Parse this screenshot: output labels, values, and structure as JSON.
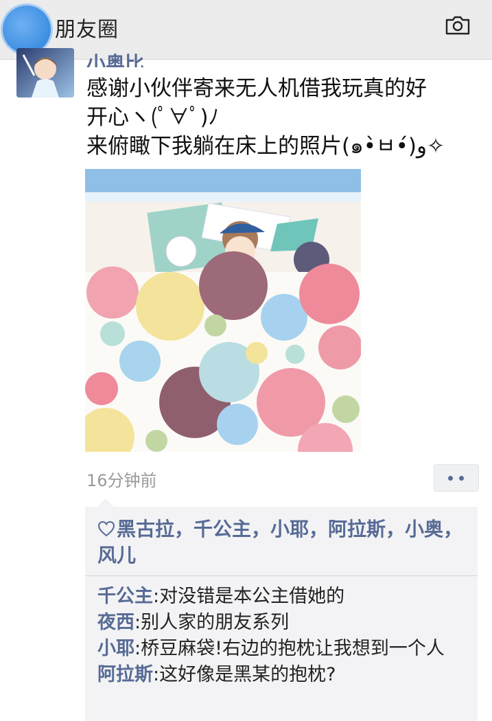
{
  "header": {
    "title": "朋友圈",
    "camera_icon": "camera-icon"
  },
  "post": {
    "author": "小奥比",
    "text": "感谢小伙伴寄来无人机借我玩真的好\n开心ヽ(ﾟ∀ﾟ)ﾉ\n来俯瞰下我躺在床上的照片(๑•̀ㅂ•́)و✧",
    "time": "16分钟前"
  },
  "likes": {
    "icon": "heart-icon",
    "names": "黑古拉，千公主，小耶，阿拉斯，小奥，风儿"
  },
  "comments": [
    {
      "author": "千公主",
      "sep": ":",
      "text": "对没错是本公主借她的"
    },
    {
      "author": "夜西",
      "sep": ":",
      "text": "别人家的朋友系列"
    },
    {
      "author": "小耶",
      "sep": ":",
      "text": "桥豆麻袋!右边的抱枕让我想到一个人"
    },
    {
      "author": "阿拉斯",
      "sep": ":",
      "text": "这好像是黑某的抱枕?"
    }
  ],
  "colors": {
    "link": "#576b95",
    "header_bg": "#ececec",
    "comment_bg": "#f3f3f5"
  }
}
